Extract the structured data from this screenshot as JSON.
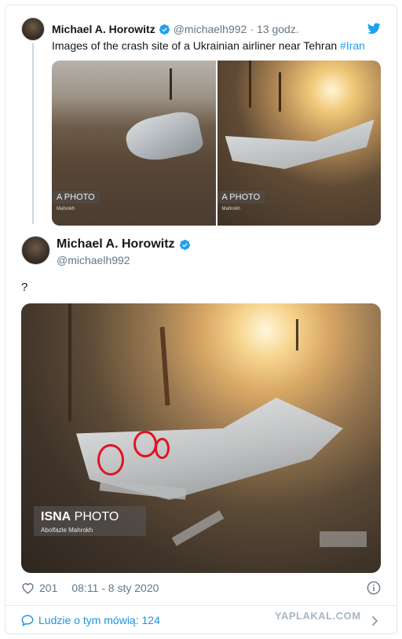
{
  "quoted": {
    "name": "Michael A. Horowitz",
    "handle": "@michaelh992",
    "separator": "·",
    "time": "13 godz.",
    "text": "Images of the crash site of a Ukrainian airliner near Tehran ",
    "hashtag": "#Iran",
    "photo1_watermark": "A PHOTO",
    "photo1_credit": "Mahrokh",
    "photo2_watermark": "A PHOTO",
    "photo2_credit": "Mahrokh"
  },
  "tweet": {
    "name": "Michael A. Horowitz",
    "handle": "@michaelh992",
    "text": "?",
    "photo_brand": "ISNA",
    "photo_brand_suffix": " PHOTO",
    "photo_credit": "Abolfazle Mahrokh",
    "likes": "201",
    "timestamp": "08:11 - 8 sty 2020"
  },
  "footer": {
    "people_talking": "Ludzie o tym mówią: 124"
  },
  "site_watermark": "YAPLAKAL.COM",
  "colors": {
    "link": "#1da1f2",
    "secondary_text": "#657786",
    "annotation_circle": "#e0141e"
  },
  "icons": [
    "verified-badge-icon",
    "twitter-bird-icon",
    "heart-icon",
    "info-icon",
    "speech-bubble-icon",
    "chevron-right-icon"
  ]
}
